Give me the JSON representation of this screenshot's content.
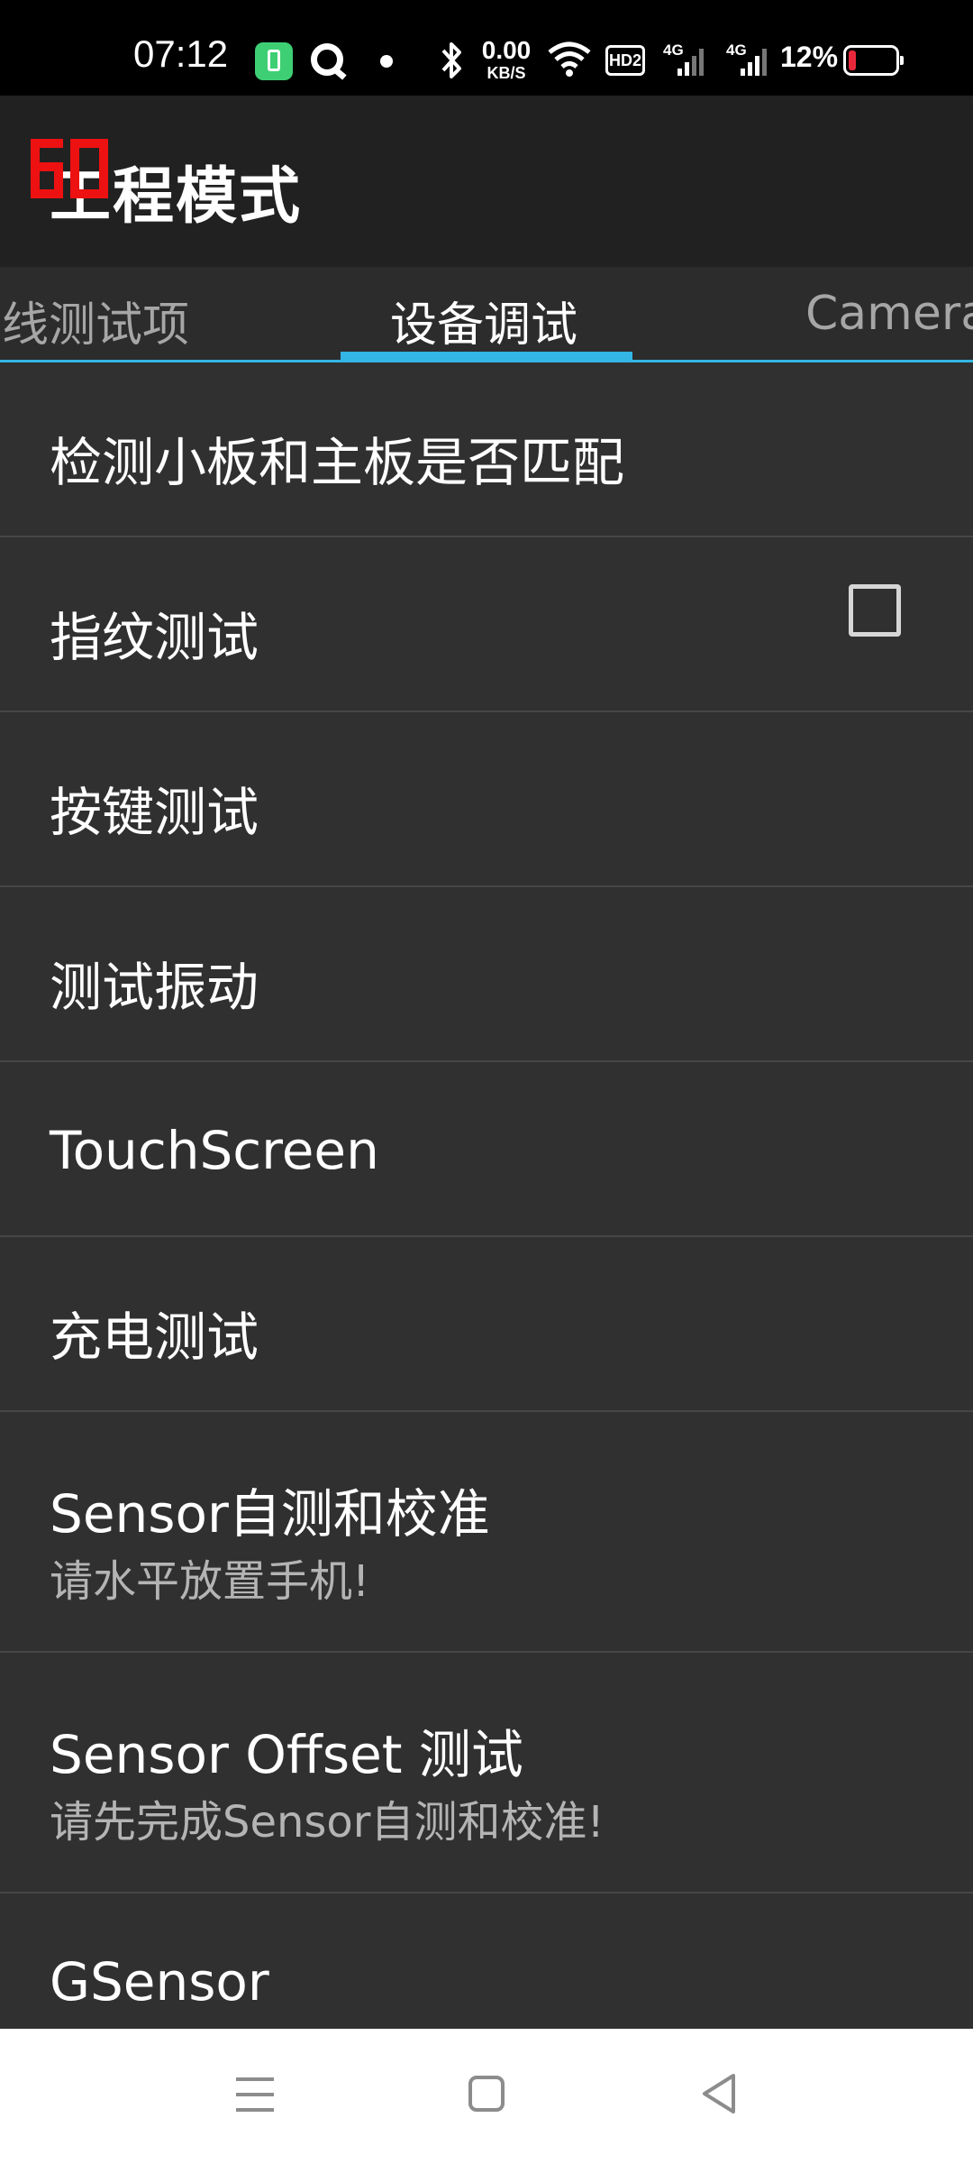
{
  "status_bar": {
    "time": "07:12",
    "net_speed_value": "0.00",
    "net_speed_unit": "KB/S",
    "hd_label": "HD2",
    "signal_1_label": "4G",
    "signal_2_label": "4G",
    "battery_percent": "12%"
  },
  "app_bar": {
    "title": "工程模式"
  },
  "tabs": [
    {
      "label": "线测试项"
    },
    {
      "label": "设备调试"
    },
    {
      "label": "Camera"
    }
  ],
  "active_tab_index": 1,
  "list_items": [
    {
      "title": "检测小板和主板是否匹配"
    },
    {
      "title": "指纹测试"
    },
    {
      "title": "按键测试"
    },
    {
      "title": "测试振动",
      "checked": false
    },
    {
      "title": "TouchScreen"
    },
    {
      "title": "充电测试"
    },
    {
      "title": "Sensor自测和校准",
      "subtitle": "请水平放置手机!"
    },
    {
      "title": "Sensor Offset 测试",
      "subtitle": "请先完成Sensor自测和校准!"
    },
    {
      "title": "GSensor"
    }
  ],
  "colors": {
    "accent": "#33b5e5",
    "background": "#303030",
    "app_bar": "#212121",
    "battery_low": "#e8283a"
  },
  "icons": {
    "app_logo": "red-gear-logo-icon",
    "nav_menu": "menu-icon",
    "nav_home": "home-icon",
    "nav_back": "back-icon"
  }
}
